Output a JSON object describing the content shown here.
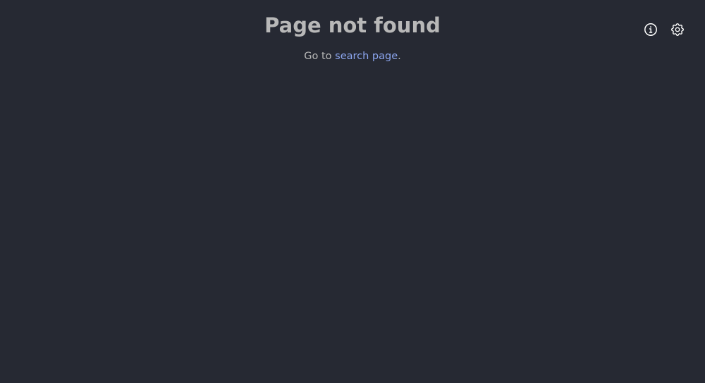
{
  "page": {
    "title": "Page not found",
    "message_prefix": "Go to ",
    "link_text": "search page",
    "message_suffix": "."
  },
  "toolbar": {
    "info_icon": "info-icon",
    "settings_icon": "gear-icon"
  },
  "colors": {
    "background": "#262933",
    "text": "#b8b8b8",
    "link": "#8ca6f0",
    "icon": "#ffffff"
  }
}
